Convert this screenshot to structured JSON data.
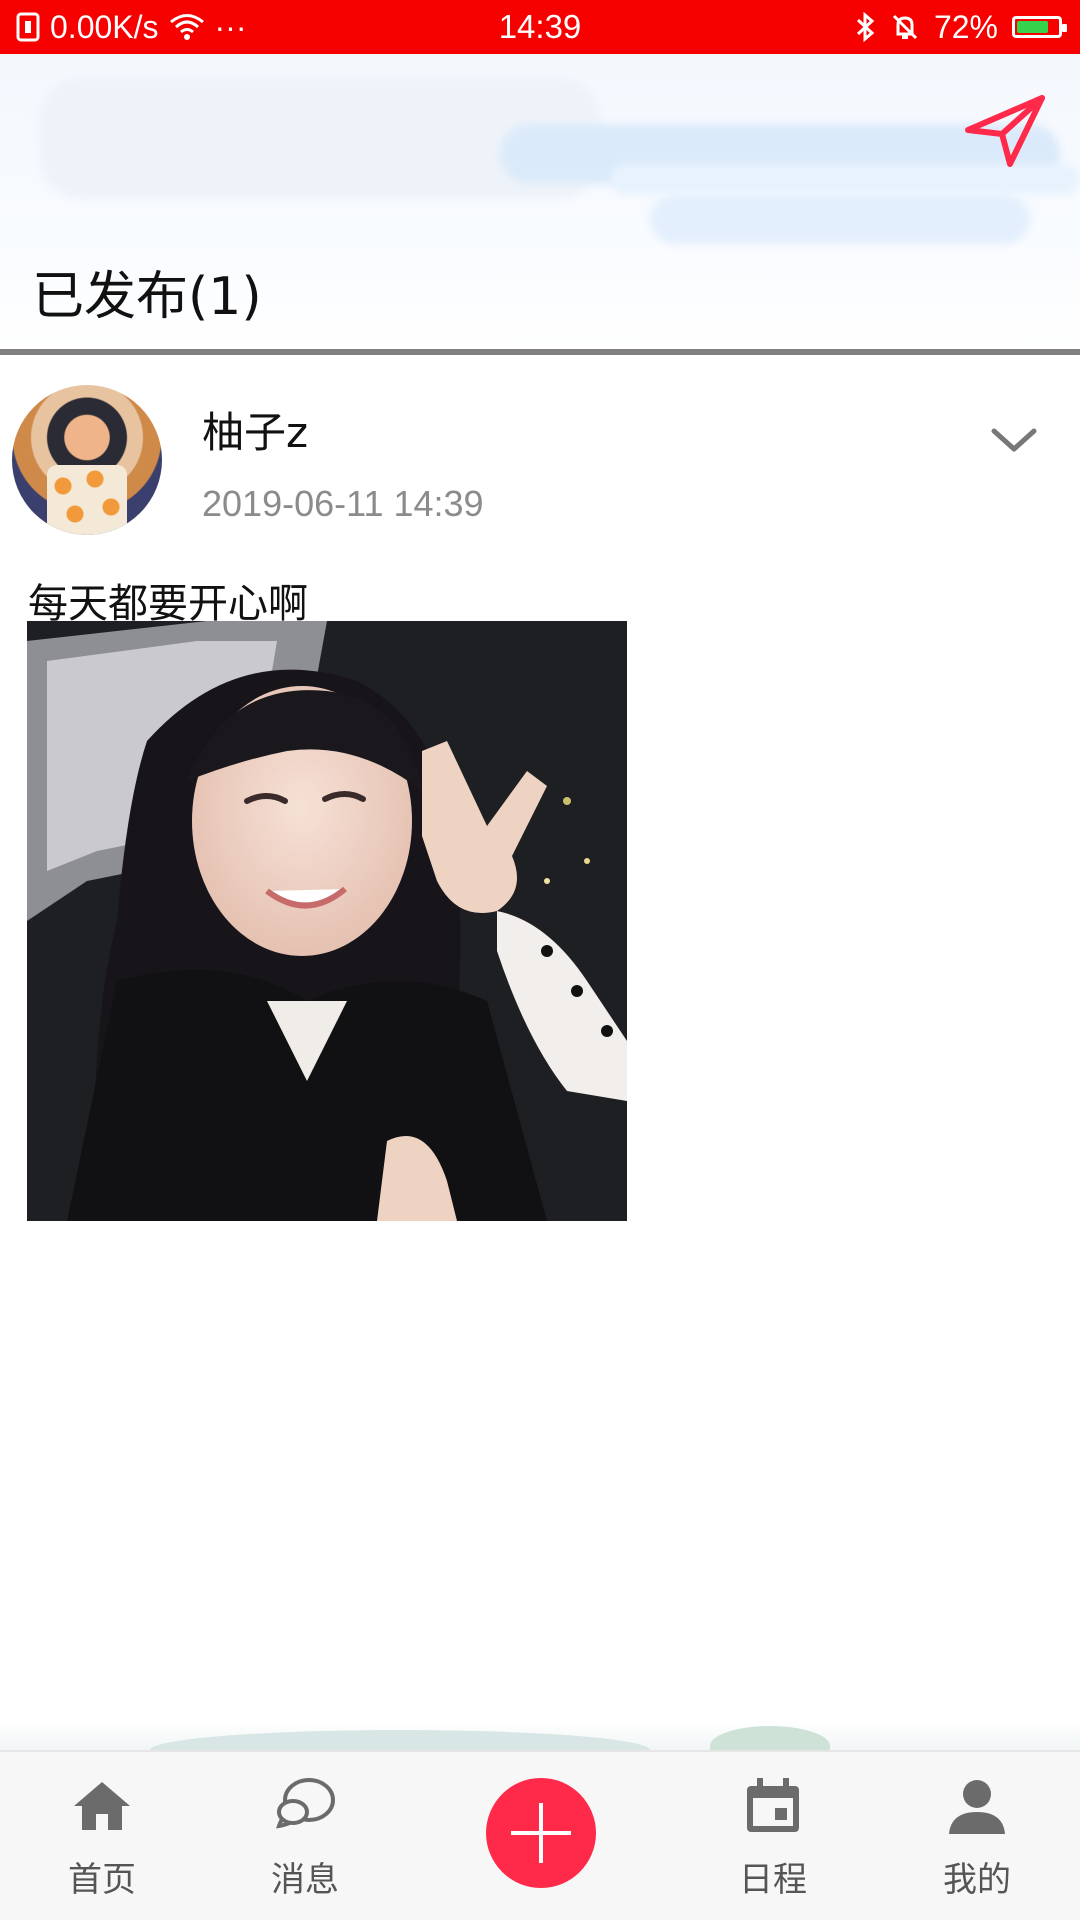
{
  "status_bar": {
    "net_speed": "0.00K/s",
    "dots": "···",
    "time": "14:39",
    "battery": "72%"
  },
  "header": {
    "title": "已发布(1)"
  },
  "post": {
    "username": "柚子z",
    "timestamp": "2019-06-11 14:39",
    "text": "每天都要开心啊"
  },
  "bottom_nav": {
    "items": [
      {
        "label": "首页",
        "icon": "home-icon"
      },
      {
        "label": "消息",
        "icon": "chat-icon"
      },
      {
        "label": "",
        "icon": "plus-icon"
      },
      {
        "label": "日程",
        "icon": "calendar-icon"
      },
      {
        "label": "我的",
        "icon": "person-icon"
      }
    ]
  },
  "colors": {
    "status_bar": "#f70000",
    "accent": "#ff2a4a",
    "nav_icon": "#6b6b6b"
  }
}
